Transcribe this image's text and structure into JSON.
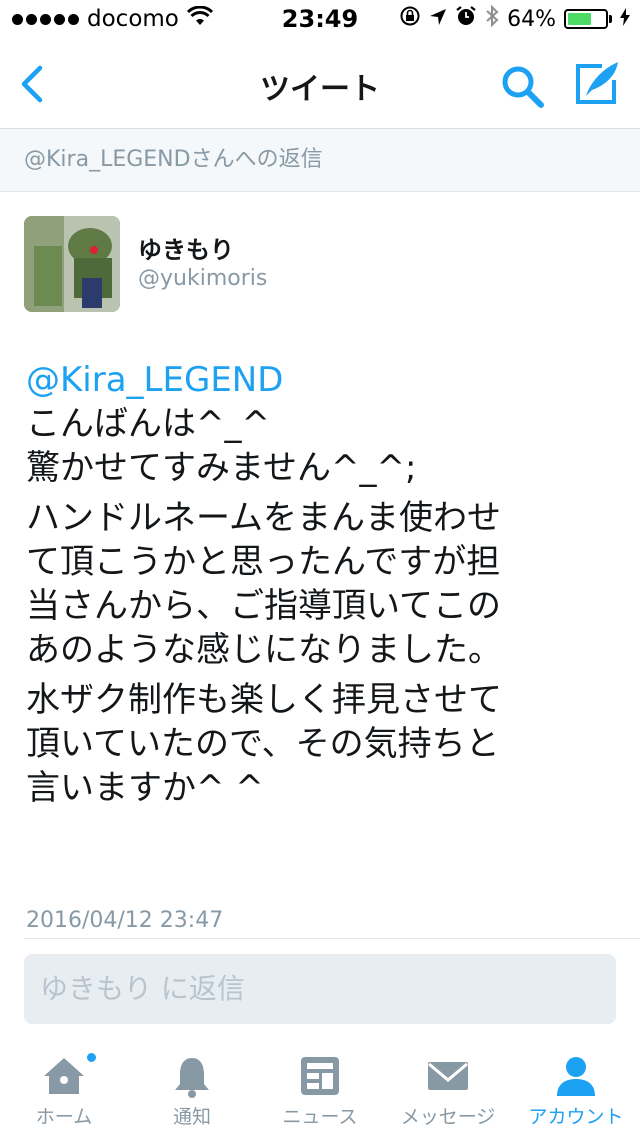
{
  "status_bar": {
    "carrier": "docomo",
    "time": "23:49",
    "battery_percent": "64%",
    "battery_level": 0.64,
    "signal_bars": 5
  },
  "nav": {
    "title": "ツイート",
    "icons": [
      "back-chevron-icon",
      "search-icon",
      "compose-icon"
    ],
    "accent_color": "#1da1f2"
  },
  "reply_context": "@Kira_LEGENDさんへの返信",
  "tweet": {
    "display_name": "ゆきもり",
    "screen_name": "@yukimoris",
    "mention": "@Kira_LEGEND",
    "lines": [
      "こんばんは^_^",
      "驚かせてすみません^_^;",
      "ハンドルネームをまんま使わせ",
      "て頂こうかと思ったんですが担",
      "当さんから、ご指導頂いてこの",
      "あのような感じになりました。",
      "水ザク制作も楽しく拝見させて",
      "頂いていたので、その気持ちと",
      "言いますか^ ^"
    ],
    "timestamp": "2016/04/12 23:47"
  },
  "reply_input": {
    "placeholder": "ゆきもり に返信"
  },
  "tab_bar": {
    "tabs": [
      {
        "label": "ホーム",
        "icon": "home-icon",
        "active": false,
        "badge": true
      },
      {
        "label": "通知",
        "icon": "bell-icon",
        "active": false,
        "badge": false
      },
      {
        "label": "ニュース",
        "icon": "news-icon",
        "active": false,
        "badge": false
      },
      {
        "label": "メッセージ",
        "icon": "envelope-icon",
        "active": false,
        "badge": false
      },
      {
        "label": "アカウント",
        "icon": "person-icon",
        "active": true,
        "badge": false
      }
    ],
    "inactive_color": "#8899a6",
    "active_color": "#1da1f2"
  }
}
